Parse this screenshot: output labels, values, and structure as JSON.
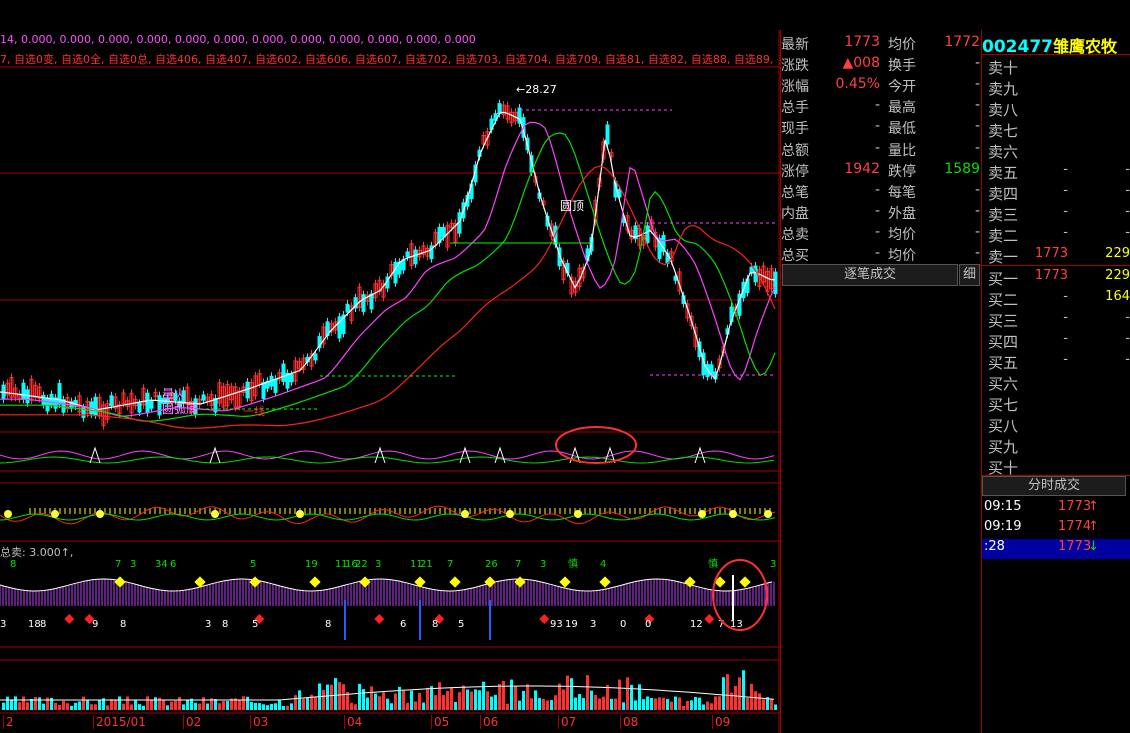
{
  "top_bar": {
    "series_values": "14, 0.000, 0.000, 0.000, 0.000, 0.000, 0.000, 0.000, 0.000, 0.000, 0.000, 0.000, 0.000",
    "selection_labels": "7, 自选0变, 自选0全, 自选0总, 自选406, 自选407, 自选602, 自选606, 自选607, 自选702, 自选703, 自选704, 自选709, 自选81, 自选82, 自选88, 自选89, 自选"
  },
  "price_chart": {
    "peak_label": "28.27",
    "pattern_labels": [
      "圆顶",
      "圆弧底",
      "量火",
      "一线",
      "顶",
      "底"
    ],
    "colors": {
      "up": "#ff3030",
      "down": "#00ffff",
      "ma1": "#ffffff",
      "ma2": "#ff40ff",
      "ma3": "#00e000",
      "ma4": "#ff2020"
    }
  },
  "indicator2": {
    "label": "总卖: 3.000↑,",
    "top_numbers": [
      "8",
      "7",
      "3",
      "34",
      "6",
      "5",
      "19",
      "11",
      "16",
      "22",
      "3",
      "11",
      "21",
      "7",
      "26",
      "7",
      "3",
      "慎",
      "4",
      "慎",
      "3"
    ],
    "bottom_numbers": [
      "3",
      "18",
      "8",
      "9",
      "8",
      "3",
      "8",
      "5",
      "8",
      "6",
      "8",
      "5",
      "0",
      "93",
      "19",
      "3",
      "0",
      "12",
      "7",
      "13"
    ]
  },
  "time_axis": {
    "labels": [
      "2",
      "2015/01",
      "02",
      "03",
      "04",
      "05",
      "06",
      "07",
      "08",
      "09"
    ]
  },
  "quote": {
    "rows": [
      {
        "l1": "最新",
        "v1": "1773",
        "l2": "均价",
        "v2": "1772"
      },
      {
        "l1": "涨跌",
        "v1": "▲008",
        "l2": "换手",
        "v2": "-"
      },
      {
        "l1": "涨幅",
        "v1": "0.45%",
        "l2": "今开",
        "v2": "-"
      },
      {
        "l1": "总手",
        "v1": "-",
        "l2": "最高",
        "v2": "-"
      },
      {
        "l1": "现手",
        "v1": "-",
        "l2": "最低",
        "v2": "-"
      },
      {
        "l1": "总额",
        "v1": "-",
        "l2": "量比",
        "v2": "-"
      },
      {
        "l1": "涨停",
        "v1": "1942",
        "l2": "跌停",
        "v2": "1589"
      },
      {
        "l1": "总笔",
        "v1": "-",
        "l2": "每笔",
        "v2": "-"
      },
      {
        "l1": "内盘",
        "v1": "-",
        "l2": "外盘",
        "v2": "-"
      },
      {
        "l1": "总卖",
        "v1": "-",
        "l2": "均价",
        "v2": "-"
      },
      {
        "l1": "总买",
        "v1": "-",
        "l2": "均价",
        "v2": "-"
      }
    ],
    "tab_trades": "逐笔成交",
    "tab_detail": "细"
  },
  "stock": {
    "code": "002477",
    "name": "雏鹰农牧"
  },
  "order_book": {
    "rows": [
      {
        "label": "卖十",
        "price": "",
        "vol": ""
      },
      {
        "label": "卖九",
        "price": "",
        "vol": ""
      },
      {
        "label": "卖八",
        "price": "",
        "vol": ""
      },
      {
        "label": "卖七",
        "price": "",
        "vol": ""
      },
      {
        "label": "卖六",
        "price": "",
        "vol": ""
      },
      {
        "label": "卖五",
        "price": "-",
        "vol": "-"
      },
      {
        "label": "卖四",
        "price": "-",
        "vol": "-"
      },
      {
        "label": "卖三",
        "price": "-",
        "vol": "-"
      },
      {
        "label": "卖二",
        "price": "-",
        "vol": "-"
      },
      {
        "label": "卖一",
        "price": "1773",
        "vol": "229"
      },
      {
        "label": "买一",
        "price": "1773",
        "vol": "229"
      },
      {
        "label": "买二",
        "price": "-",
        "vol": "164"
      },
      {
        "label": "买三",
        "price": "-",
        "vol": "-"
      },
      {
        "label": "买四",
        "price": "-",
        "vol": "-"
      },
      {
        "label": "买五",
        "price": "-",
        "vol": "-"
      },
      {
        "label": "买六",
        "price": "",
        "vol": ""
      },
      {
        "label": "买七",
        "price": "",
        "vol": ""
      },
      {
        "label": "买八",
        "price": "",
        "vol": ""
      },
      {
        "label": "买九",
        "price": "",
        "vol": ""
      },
      {
        "label": "买十",
        "price": "",
        "vol": ""
      }
    ]
  },
  "time_trades": {
    "title": "分时成交",
    "rows": [
      {
        "time": "09:15",
        "price": "1773",
        "arrow": "↑"
      },
      {
        "time": "09:19",
        "price": "1774",
        "arrow": "↑"
      },
      {
        "time": ":28",
        "price": "1773",
        "arrow": "↓"
      }
    ]
  }
}
